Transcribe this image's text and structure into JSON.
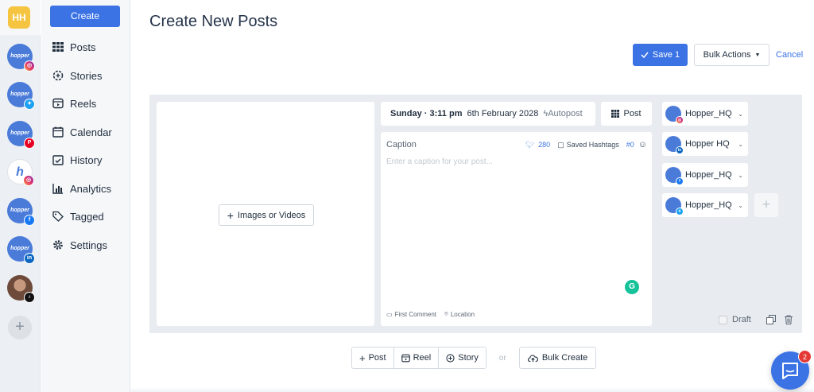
{
  "rail": {
    "workspace_initials": "HH",
    "accounts": [
      {
        "label": "hopper",
        "network": "instagram"
      },
      {
        "label": "hopper",
        "network": "twitter"
      },
      {
        "label": "hopper",
        "network": "pinterest"
      },
      {
        "label": "h",
        "network": "instagram"
      },
      {
        "label": "hopper",
        "network": "facebook"
      },
      {
        "label": "hopper",
        "network": "linkedin"
      },
      {
        "label": "",
        "network": "tiktok"
      }
    ],
    "add_symbol": "+"
  },
  "nav": {
    "create_label": "Create",
    "items": [
      {
        "label": "Posts",
        "icon": "grid-icon"
      },
      {
        "label": "Stories",
        "icon": "stories-icon"
      },
      {
        "label": "Reels",
        "icon": "reels-icon"
      },
      {
        "label": "Calendar",
        "icon": "calendar-icon"
      },
      {
        "label": "History",
        "icon": "history-icon"
      },
      {
        "label": "Analytics",
        "icon": "analytics-icon"
      },
      {
        "label": "Tagged",
        "icon": "tag-icon"
      },
      {
        "label": "Settings",
        "icon": "gear-icon"
      }
    ]
  },
  "header": {
    "title": "Create New Posts",
    "save_label": "Save 1",
    "bulk_actions_label": "Bulk Actions",
    "cancel_label": "Cancel"
  },
  "editor": {
    "media_button_label": "Images or Videos",
    "schedule_day_time": "Sunday · 3:11 pm",
    "schedule_date": "6th February 2028",
    "autopost_label": "Autopost",
    "post_type_label": "Post",
    "caption_label": "Caption",
    "char_count": "280",
    "saved_hashtags_label": "Saved Hashtags",
    "hashtag_count": "#0",
    "caption_placeholder": "Enter a caption for your post...",
    "first_comment_label": "First Comment",
    "location_label": "Location",
    "draft_label": "Draft"
  },
  "account_selectors": [
    {
      "name": "Hopper_HQ",
      "network": "instagram"
    },
    {
      "name": "Hopper HQ",
      "network": "linkedin"
    },
    {
      "name": "Hopper_HQ",
      "network": "facebook"
    },
    {
      "name": "Hopper_HQ",
      "network": "twitter"
    }
  ],
  "bottom": {
    "post_label": "Post",
    "reel_label": "Reel",
    "story_label": "Story",
    "or_label": "or",
    "bulk_create_label": "Bulk Create"
  },
  "chat": {
    "unread": "2"
  },
  "colors": {
    "accent": "#3b73e5",
    "workspace": "#f5c542"
  }
}
